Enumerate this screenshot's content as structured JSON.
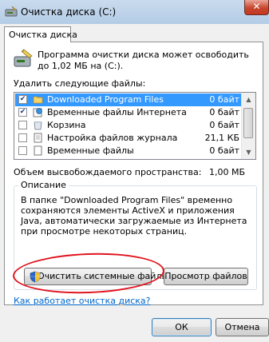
{
  "window": {
    "title": "Очистка диска  (C:)",
    "close_glyph": "✕"
  },
  "tab": {
    "label": "Очистка диска"
  },
  "header": {
    "text": "Программа очистки диска может освободить до 1,02 МБ на  (C:)."
  },
  "files_section": {
    "label": "Удалить следующие файлы:",
    "items": [
      {
        "name": "Downloaded Program Files",
        "size": "0 байт",
        "checked": true,
        "selected": true,
        "icon": "folder-icon"
      },
      {
        "name": "Временные файлы Интернета",
        "size": "0 байт",
        "checked": true,
        "selected": false,
        "icon": "internet-files-icon"
      },
      {
        "name": "Корзина",
        "size": "0 байт",
        "checked": false,
        "selected": false,
        "icon": "recycle-bin-icon"
      },
      {
        "name": "Настройка файлов журнала",
        "size": "21,1 КБ",
        "checked": false,
        "selected": false,
        "icon": "log-files-icon"
      },
      {
        "name": "Временные файлы",
        "size": "0 байт",
        "checked": false,
        "selected": false,
        "icon": "temp-files-icon"
      }
    ]
  },
  "space": {
    "label": "Объем высвобождаемого пространства:",
    "value": "1,00 МБ"
  },
  "description": {
    "legend": "Описание",
    "text": "В папке \"Downloaded Program Files\" временно сохраняются элементы ActiveX и приложения Java, автоматически загружаемые из Интернета при просмотре некоторых страниц."
  },
  "buttons": {
    "clean_system": "Очистить системные файлы",
    "view_files": "Просмотр файлов",
    "ok": "ОК",
    "cancel": "Отмена"
  },
  "link": {
    "text": "Как работает очистка диска?"
  },
  "colors": {
    "selection": "#3399ff",
    "annotation_oval": "#e0141e",
    "link": "#0066cc"
  }
}
